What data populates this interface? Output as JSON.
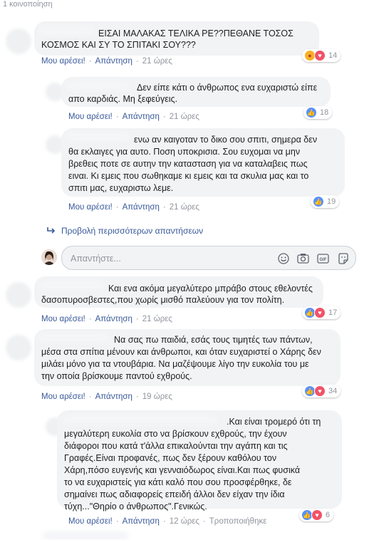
{
  "share_count": "1 κοινοποίηση",
  "labels": {
    "like": "Μου αρέσει!",
    "reply": "Απάντηση",
    "edited": "Τροποποιήθηκε"
  },
  "comments": [
    {
      "lines": [
        "ΕΙΣΑΙ ΜΑΛΑΚΑΣ ΤΕΛΙΚΑ ΡΕ??ΠΕΘΑΝΕ ΤΟΣΟΣ",
        "ΚΟΣΜΟΣ ΚΑΙ ΣΥ ΤΟ ΣΠΙΤΑΚΙ ΣΟΥ???"
      ],
      "time": "21 ώρες",
      "reactions": [
        "angry",
        "love"
      ],
      "count": "14"
    },
    {
      "lines": [
        "Δεν είπε κάτι ο άνθρωπος ενα ευχαριστώ είπε",
        "απο καρδιάς. Μη ξεφεύγεις."
      ],
      "time": "21 ώρες",
      "reactions": [
        "like"
      ],
      "count": "18"
    },
    {
      "lines": [
        "ενω αν καιγοταν το δικο σου σπιτι, σημερα δεν",
        "θα εκλαιγες για αυτο. Ποση υποκρισια. Σου ευχομαι να μην",
        "βρεθεις ποτε σε αυτην την κατασταση για να καταλαβεις πως",
        "ειναι. Κι εμεις που σωθηκαμε κι εμεις και τα σκυλια μας και το",
        "σπιτι μας, ευχαριστω λεμε."
      ],
      "time": "21 ώρες",
      "reactions": [
        "like"
      ],
      "count": "19"
    },
    {
      "lines": [
        "Και ενα ακόμα μεγαλύτερο μπράβο στους εθελοντές",
        "δασοπυροσβεστες,που χωρίς μισθό παλεύουν για τον πολίτη."
      ],
      "time": "21 ώρες",
      "reactions": [
        "like",
        "love"
      ],
      "count": "17"
    },
    {
      "lines": [
        "Να σας πω παιδιά, εσάς τους τιμητές των πάντων,",
        "μέσα στα σπίτια μένουν και άνθρωποι, και όταν ευχαριστεί ο Χάρης δεν",
        "μιλάει μόνο για τα ντουβάρια. Να μαζέψουμε λίγο την ευκολία του με",
        "την οποία βρίσκουμε παντού εχθρούς."
      ],
      "time": "19 ώρες",
      "reactions": [
        "like",
        "love"
      ],
      "count": "34"
    },
    {
      "lines": [
        ".Και είναι τρομερό ότι τη",
        "μεγαλύτερη ευκολία στο να βρίσκουν εχθρούς, την έχουν",
        "διάφοροι που κατά τ'άλλα επικαλούνται την αγάπη και τις",
        "Γραφές.Είναι προφανές, πως δεν ξέρουν καθόλου τον",
        "Χάρη,πόσο ευγενής και γενναιόδωρος είναι.Και πως φυσικά",
        "το να ευχαριστείς για κάτι καλό που σου προσφέρθηκε, δε",
        "σημαίνει πως αδιαφορείς επειδή άλλοι δεν είχαν την ίδια",
        "τύχη...\"Θηρίο ο άνθρωπος\".Γενικώς."
      ],
      "time": "12 ώρες",
      "reactions": [
        "like",
        "love"
      ],
      "count": "6"
    }
  ],
  "more_replies": "Προβολή περισσότερων απαντήσεων",
  "reply_placeholder": "Απαντήστε...",
  "colors": {
    "link": "#385898",
    "bubble": "#f2f3f5",
    "like": "#5890ff",
    "love": "#f25268"
  },
  "icons": [
    "reply-arrow-icon",
    "emoji-icon",
    "camera-icon",
    "gif-icon",
    "sticker-icon"
  ]
}
